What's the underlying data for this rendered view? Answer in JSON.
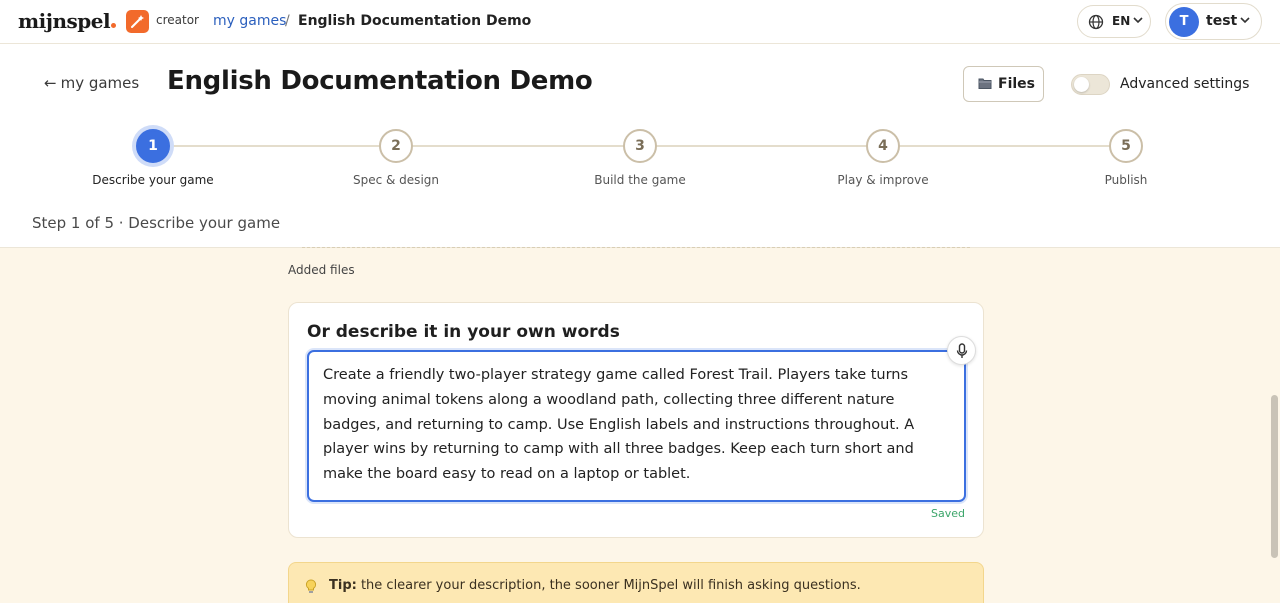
{
  "topbar": {
    "logo": "mijnspel",
    "creator_label": "creator",
    "breadcrumb": {
      "parent": "my games",
      "separator": "/",
      "current": "English Documentation Demo"
    },
    "language": "EN",
    "user": {
      "initial": "T",
      "name": "test"
    }
  },
  "header": {
    "back_label": "my games",
    "title": "English Documentation Demo",
    "files_label": "Files",
    "advanced_label": "Advanced settings",
    "advanced_enabled": false
  },
  "steps": [
    {
      "number": "1",
      "label": "Describe your game",
      "active": true
    },
    {
      "number": "2",
      "label": "Spec & design",
      "active": false
    },
    {
      "number": "3",
      "label": "Build the game",
      "active": false
    },
    {
      "number": "4",
      "label": "Play & improve",
      "active": false
    },
    {
      "number": "5",
      "label": "Publish",
      "active": false
    }
  ],
  "step_status": "Step 1 of 5 · Describe your game",
  "content": {
    "added_files_label": "Added files",
    "card_title": "Or describe it in your own words",
    "description": "Create a friendly two-player strategy game called Forest Trail. Players take turns moving animal tokens along a woodland path, collecting three different nature badges, and returning to camp. Use English labels and instructions throughout. A player wins by returning to camp with all three badges. Keep each turn short and make the board easy to read on a laptop or tablet.",
    "saved_label": "Saved",
    "tip_bold": "Tip:",
    "tip_text": " the clearer your description, the sooner MijnSpel will finish asking questions."
  },
  "colors": {
    "accent": "#3b6fe0",
    "brand": "#f26a2b",
    "background": "#fdf6e8",
    "saved": "#3ca56a",
    "tip": "#fde8b3"
  }
}
